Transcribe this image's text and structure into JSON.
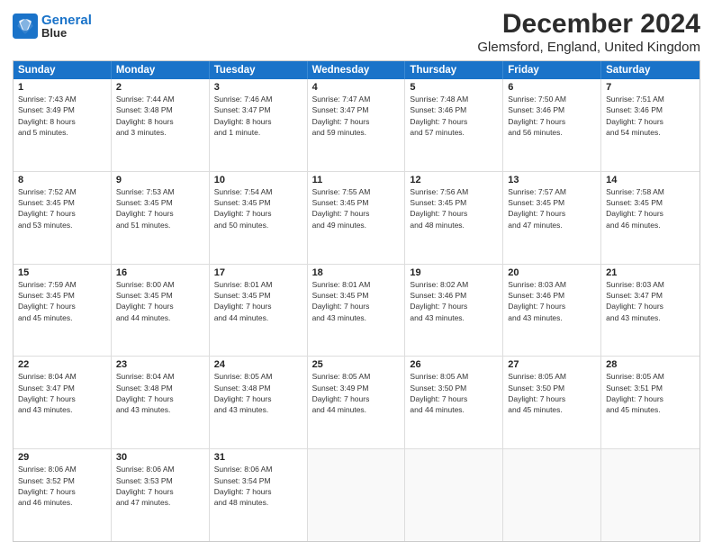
{
  "logo": {
    "line1": "General",
    "line2": "Blue"
  },
  "title": "December 2024",
  "subtitle": "Glemsford, England, United Kingdom",
  "weekdays": [
    "Sunday",
    "Monday",
    "Tuesday",
    "Wednesday",
    "Thursday",
    "Friday",
    "Saturday"
  ],
  "weeks": [
    [
      {
        "day": "1",
        "lines": [
          "Sunrise: 7:43 AM",
          "Sunset: 3:49 PM",
          "Daylight: 8 hours",
          "and 5 minutes."
        ]
      },
      {
        "day": "2",
        "lines": [
          "Sunrise: 7:44 AM",
          "Sunset: 3:48 PM",
          "Daylight: 8 hours",
          "and 3 minutes."
        ]
      },
      {
        "day": "3",
        "lines": [
          "Sunrise: 7:46 AM",
          "Sunset: 3:47 PM",
          "Daylight: 8 hours",
          "and 1 minute."
        ]
      },
      {
        "day": "4",
        "lines": [
          "Sunrise: 7:47 AM",
          "Sunset: 3:47 PM",
          "Daylight: 7 hours",
          "and 59 minutes."
        ]
      },
      {
        "day": "5",
        "lines": [
          "Sunrise: 7:48 AM",
          "Sunset: 3:46 PM",
          "Daylight: 7 hours",
          "and 57 minutes."
        ]
      },
      {
        "day": "6",
        "lines": [
          "Sunrise: 7:50 AM",
          "Sunset: 3:46 PM",
          "Daylight: 7 hours",
          "and 56 minutes."
        ]
      },
      {
        "day": "7",
        "lines": [
          "Sunrise: 7:51 AM",
          "Sunset: 3:46 PM",
          "Daylight: 7 hours",
          "and 54 minutes."
        ]
      }
    ],
    [
      {
        "day": "8",
        "lines": [
          "Sunrise: 7:52 AM",
          "Sunset: 3:45 PM",
          "Daylight: 7 hours",
          "and 53 minutes."
        ]
      },
      {
        "day": "9",
        "lines": [
          "Sunrise: 7:53 AM",
          "Sunset: 3:45 PM",
          "Daylight: 7 hours",
          "and 51 minutes."
        ]
      },
      {
        "day": "10",
        "lines": [
          "Sunrise: 7:54 AM",
          "Sunset: 3:45 PM",
          "Daylight: 7 hours",
          "and 50 minutes."
        ]
      },
      {
        "day": "11",
        "lines": [
          "Sunrise: 7:55 AM",
          "Sunset: 3:45 PM",
          "Daylight: 7 hours",
          "and 49 minutes."
        ]
      },
      {
        "day": "12",
        "lines": [
          "Sunrise: 7:56 AM",
          "Sunset: 3:45 PM",
          "Daylight: 7 hours",
          "and 48 minutes."
        ]
      },
      {
        "day": "13",
        "lines": [
          "Sunrise: 7:57 AM",
          "Sunset: 3:45 PM",
          "Daylight: 7 hours",
          "and 47 minutes."
        ]
      },
      {
        "day": "14",
        "lines": [
          "Sunrise: 7:58 AM",
          "Sunset: 3:45 PM",
          "Daylight: 7 hours",
          "and 46 minutes."
        ]
      }
    ],
    [
      {
        "day": "15",
        "lines": [
          "Sunrise: 7:59 AM",
          "Sunset: 3:45 PM",
          "Daylight: 7 hours",
          "and 45 minutes."
        ]
      },
      {
        "day": "16",
        "lines": [
          "Sunrise: 8:00 AM",
          "Sunset: 3:45 PM",
          "Daylight: 7 hours",
          "and 44 minutes."
        ]
      },
      {
        "day": "17",
        "lines": [
          "Sunrise: 8:01 AM",
          "Sunset: 3:45 PM",
          "Daylight: 7 hours",
          "and 44 minutes."
        ]
      },
      {
        "day": "18",
        "lines": [
          "Sunrise: 8:01 AM",
          "Sunset: 3:45 PM",
          "Daylight: 7 hours",
          "and 43 minutes."
        ]
      },
      {
        "day": "19",
        "lines": [
          "Sunrise: 8:02 AM",
          "Sunset: 3:46 PM",
          "Daylight: 7 hours",
          "and 43 minutes."
        ]
      },
      {
        "day": "20",
        "lines": [
          "Sunrise: 8:03 AM",
          "Sunset: 3:46 PM",
          "Daylight: 7 hours",
          "and 43 minutes."
        ]
      },
      {
        "day": "21",
        "lines": [
          "Sunrise: 8:03 AM",
          "Sunset: 3:47 PM",
          "Daylight: 7 hours",
          "and 43 minutes."
        ]
      }
    ],
    [
      {
        "day": "22",
        "lines": [
          "Sunrise: 8:04 AM",
          "Sunset: 3:47 PM",
          "Daylight: 7 hours",
          "and 43 minutes."
        ]
      },
      {
        "day": "23",
        "lines": [
          "Sunrise: 8:04 AM",
          "Sunset: 3:48 PM",
          "Daylight: 7 hours",
          "and 43 minutes."
        ]
      },
      {
        "day": "24",
        "lines": [
          "Sunrise: 8:05 AM",
          "Sunset: 3:48 PM",
          "Daylight: 7 hours",
          "and 43 minutes."
        ]
      },
      {
        "day": "25",
        "lines": [
          "Sunrise: 8:05 AM",
          "Sunset: 3:49 PM",
          "Daylight: 7 hours",
          "and 44 minutes."
        ]
      },
      {
        "day": "26",
        "lines": [
          "Sunrise: 8:05 AM",
          "Sunset: 3:50 PM",
          "Daylight: 7 hours",
          "and 44 minutes."
        ]
      },
      {
        "day": "27",
        "lines": [
          "Sunrise: 8:05 AM",
          "Sunset: 3:50 PM",
          "Daylight: 7 hours",
          "and 45 minutes."
        ]
      },
      {
        "day": "28",
        "lines": [
          "Sunrise: 8:05 AM",
          "Sunset: 3:51 PM",
          "Daylight: 7 hours",
          "and 45 minutes."
        ]
      }
    ],
    [
      {
        "day": "29",
        "lines": [
          "Sunrise: 8:06 AM",
          "Sunset: 3:52 PM",
          "Daylight: 7 hours",
          "and 46 minutes."
        ]
      },
      {
        "day": "30",
        "lines": [
          "Sunrise: 8:06 AM",
          "Sunset: 3:53 PM",
          "Daylight: 7 hours",
          "and 47 minutes."
        ]
      },
      {
        "day": "31",
        "lines": [
          "Sunrise: 8:06 AM",
          "Sunset: 3:54 PM",
          "Daylight: 7 hours",
          "and 48 minutes."
        ]
      },
      {
        "day": "",
        "lines": []
      },
      {
        "day": "",
        "lines": []
      },
      {
        "day": "",
        "lines": []
      },
      {
        "day": "",
        "lines": []
      }
    ]
  ]
}
